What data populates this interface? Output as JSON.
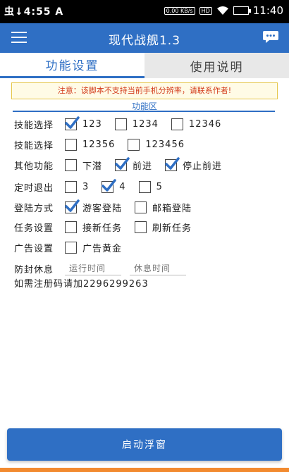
{
  "status_bar": {
    "left_text": "虫↓4:55 A",
    "net_label": "0.00 KB/s",
    "hd_label": "HD",
    "time": "11:40"
  },
  "app_bar": {
    "title": "现代战舰1.3"
  },
  "tabs": [
    {
      "label": "功能设置",
      "active": true
    },
    {
      "label": "使用说明",
      "active": false
    }
  ],
  "notice": "注意：该脚本不支持当前手机分辨率，请联系作者!",
  "section_title": "功能区",
  "rows": [
    {
      "label": "技能选择",
      "options": [
        {
          "label": "123",
          "checked": true
        },
        {
          "label": "1234",
          "checked": false
        },
        {
          "label": "12346",
          "checked": false
        }
      ]
    },
    {
      "label": "技能选择",
      "options": [
        {
          "label": "12356",
          "checked": false
        },
        {
          "label": "123456",
          "checked": false
        }
      ]
    },
    {
      "label": "其他功能",
      "options": [
        {
          "label": "下潜",
          "checked": false
        },
        {
          "label": "前进",
          "checked": true
        },
        {
          "label": "停止前进",
          "checked": true
        }
      ]
    },
    {
      "label": "定时退出",
      "options": [
        {
          "label": "3",
          "checked": false
        },
        {
          "label": "4",
          "checked": true
        },
        {
          "label": "5",
          "checked": false
        }
      ]
    },
    {
      "label": "登陆方式",
      "options": [
        {
          "label": "游客登陆",
          "checked": true
        },
        {
          "label": "邮箱登陆",
          "checked": false
        }
      ]
    },
    {
      "label": "任务设置",
      "options": [
        {
          "label": "接新任务",
          "checked": false
        },
        {
          "label": "刷新任务",
          "checked": false
        }
      ]
    },
    {
      "label": "广告设置",
      "options": [
        {
          "label": "广告黄金",
          "checked": false
        }
      ]
    }
  ],
  "anti_ban": {
    "label": "防封休息",
    "run_time_placeholder": "运行时间",
    "rest_time_placeholder": "休息时间"
  },
  "info_line": "如需注册码请加2296299263",
  "start_button": "启动浮窗",
  "accent_color": "#2f6fc4"
}
